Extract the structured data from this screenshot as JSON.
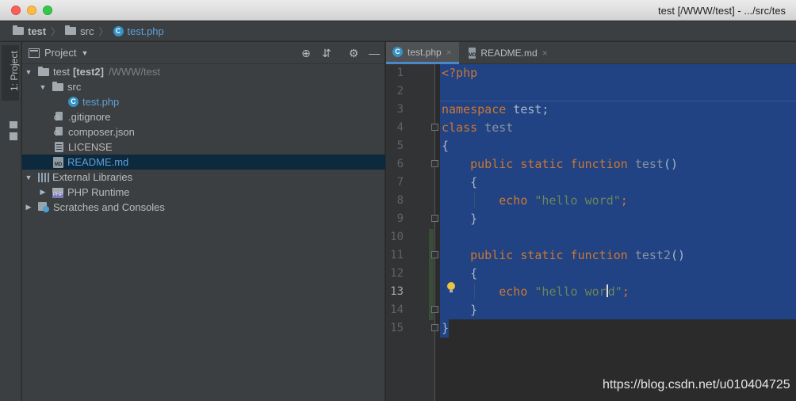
{
  "window": {
    "title": "test [/WWW/test] - .../src/tes"
  },
  "breadcrumb": [
    {
      "label": "test",
      "icon": "folder-icon"
    },
    {
      "label": "src",
      "icon": "folder-icon"
    },
    {
      "label": "test.php",
      "icon": "php-class-icon"
    }
  ],
  "toolwindow": {
    "tab_label": "1: Project"
  },
  "project_panel": {
    "title": "Project",
    "tree": [
      {
        "label": "test",
        "suffix": "[test2]",
        "path": "/WWW/test",
        "arrow": "▼",
        "icon": "folder-icon"
      },
      {
        "label": "src",
        "arrow": "▼",
        "icon": "folder-icon"
      },
      {
        "label": "test.php",
        "icon": "php-class-icon"
      },
      {
        "label": ".gitignore",
        "icon": "gear-file-icon"
      },
      {
        "label": "composer.json",
        "icon": "gear-file-icon"
      },
      {
        "label": "LICENSE",
        "icon": "text-file-icon"
      },
      {
        "label": "README.md",
        "icon": "markdown-icon",
        "selected": true
      },
      {
        "label": "External Libraries",
        "arrow": "▼",
        "icon": "library-icon"
      },
      {
        "label": "PHP Runtime",
        "arrow": "▶",
        "icon": "php-library-icon"
      },
      {
        "label": "Scratches and Consoles",
        "arrow": "▶",
        "icon": "scratch-icon"
      }
    ]
  },
  "editor": {
    "tabs": [
      {
        "label": "test.php",
        "active": true,
        "close": "×"
      },
      {
        "label": "README.md",
        "active": false,
        "close": "×"
      }
    ],
    "line_numbers": [
      "1",
      "2",
      "3",
      "4",
      "5",
      "6",
      "7",
      "8",
      "9",
      "10",
      "11",
      "12",
      "13",
      "14",
      "15"
    ],
    "current_line": 13,
    "code": {
      "l1": "<?php",
      "l3_kw": "namespace",
      "l3_rest": " test;",
      "l4_kw": "class",
      "l4_name": " test",
      "l5": "{",
      "l6_kw": "    public static function",
      "l6_name": " test",
      "l6_rest": "()",
      "l7": "    {",
      "l8_kw": "        echo",
      "l8_str": " \"hello word\"",
      "l8_rest": ";",
      "l9": "    }",
      "l11_kw": "    public static function",
      "l11_name": " test2",
      "l11_rest": "()",
      "l12": "    {",
      "l13_kw": "        echo",
      "l13_str_a": " \"hello wor",
      "l13_str_b": "d\"",
      "l13_rest": ";",
      "l14": "    }",
      "l15": "}"
    }
  },
  "watermark": "https://blog.csdn.net/u010404725",
  "colors": {
    "selection": "#214283",
    "keyword": "#cc7832",
    "string": "#6a8759",
    "accent": "#4a88c7"
  }
}
